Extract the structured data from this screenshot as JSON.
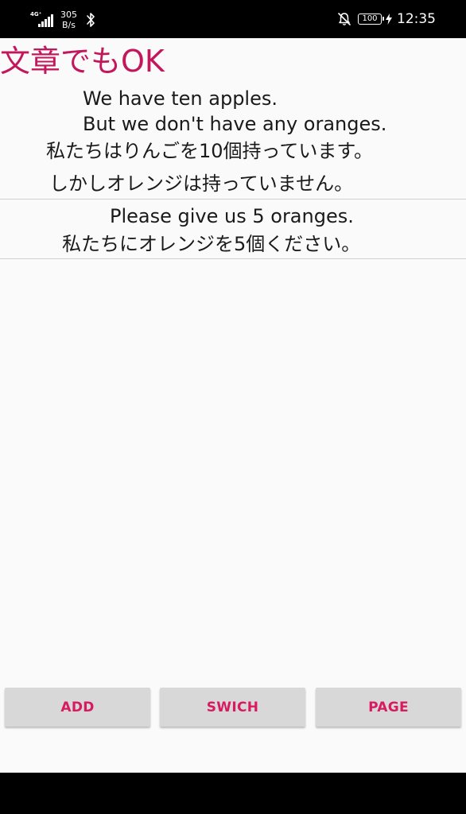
{
  "status_bar": {
    "network_type": "4G⁺",
    "net_speed_value": "305",
    "net_speed_unit": "B/s",
    "battery_level": "100",
    "time": "12:35",
    "icons": [
      "signal-icon",
      "bluetooth-icon",
      "mute-icon",
      "battery-icon",
      "charging-icon"
    ]
  },
  "title": "文章でもOK",
  "items": [
    {
      "lines": [
        "We have ten apples.",
        "But we don't have any oranges.",
        "私たちはりんごを10個持っています。",
        "しかしオレンジは持っていません。"
      ]
    },
    {
      "lines": [
        "Please give us 5 oranges.",
        "私たちにオレンジを5個ください。"
      ]
    }
  ],
  "buttons": {
    "add": "ADD",
    "switch": "SWICH",
    "page": "PAGE"
  },
  "colors": {
    "accent": "#c2185b",
    "button_text": "#d81b60",
    "button_bg": "#d8d8d8",
    "background": "#fafafa"
  }
}
